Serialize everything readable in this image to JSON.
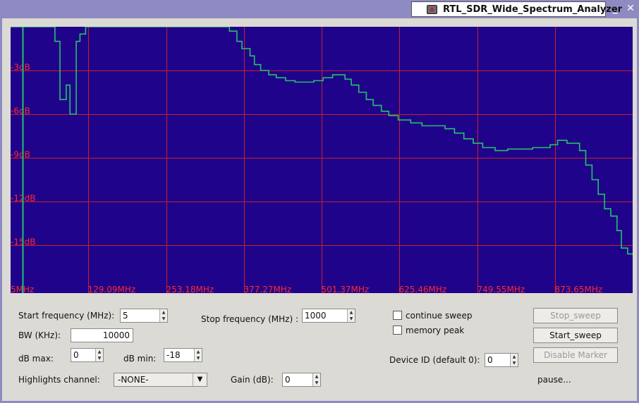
{
  "window": {
    "title": "RTL_SDR_Wide_Spectrum_Analyzer",
    "minimize_glyph": "_",
    "close_glyph": "✕"
  },
  "plot": {
    "colors": {
      "background": "#20038b",
      "grid": "#cc1e28",
      "trace": "#22c26a",
      "labels": "#ff2a2a"
    },
    "y_labels": [
      "-3dB",
      "-6dB",
      "-9dB",
      "-12dB",
      "-15dB"
    ],
    "x_labels": [
      "5MHz",
      "129.09MHz",
      "253.18MHz",
      "377.27MHz",
      "501.37MHz",
      "625.46MHz",
      "749.55MHz",
      "873.65MHz"
    ]
  },
  "chart_data": {
    "type": "line",
    "x_unit": "MHz",
    "y_unit": "dB",
    "ylim": [
      -18,
      0
    ],
    "xlim": [
      5,
      1000
    ],
    "series": [
      {
        "values": [
          [
            5,
            0
          ],
          [
            76,
            0
          ],
          [
            76,
            -1
          ],
          [
            84,
            -1
          ],
          [
            84,
            -5
          ],
          [
            94,
            -5
          ],
          [
            94,
            -4
          ],
          [
            100,
            -4
          ],
          [
            100,
            -6
          ],
          [
            110,
            -6
          ],
          [
            110,
            -1
          ],
          [
            116,
            -1
          ],
          [
            116,
            -0.5
          ],
          [
            125,
            -0.5
          ],
          [
            125,
            0
          ],
          [
            355,
            0
          ],
          [
            355,
            -0.3
          ],
          [
            367,
            -0.3
          ],
          [
            367,
            -1
          ],
          [
            375,
            -1
          ],
          [
            375,
            -1.5
          ],
          [
            388,
            -1.5
          ],
          [
            388,
            -2
          ],
          [
            395,
            -2
          ],
          [
            395,
            -2.6
          ],
          [
            405,
            -2.6
          ],
          [
            405,
            -3
          ],
          [
            418,
            -3
          ],
          [
            418,
            -3.3
          ],
          [
            430,
            -3.3
          ],
          [
            430,
            -3.5
          ],
          [
            445,
            -3.5
          ],
          [
            445,
            -3.7
          ],
          [
            460,
            -3.7
          ],
          [
            460,
            -3.8
          ],
          [
            490,
            -3.8
          ],
          [
            490,
            -3.7
          ],
          [
            505,
            -3.7
          ],
          [
            505,
            -3.5
          ],
          [
            520,
            -3.5
          ],
          [
            520,
            -3.3
          ],
          [
            540,
            -3.3
          ],
          [
            540,
            -3.6
          ],
          [
            550,
            -3.6
          ],
          [
            550,
            -4
          ],
          [
            562,
            -4
          ],
          [
            562,
            -4.5
          ],
          [
            574,
            -4.5
          ],
          [
            574,
            -5
          ],
          [
            585,
            -5
          ],
          [
            585,
            -5.4
          ],
          [
            598,
            -5.4
          ],
          [
            598,
            -5.8
          ],
          [
            610,
            -5.8
          ],
          [
            610,
            -6.1
          ],
          [
            625,
            -6.1
          ],
          [
            625,
            -6.4
          ],
          [
            645,
            -6.4
          ],
          [
            645,
            -6.6
          ],
          [
            663,
            -6.6
          ],
          [
            663,
            -6.8
          ],
          [
            700,
            -6.8
          ],
          [
            700,
            -7
          ],
          [
            715,
            -7
          ],
          [
            715,
            -7.3
          ],
          [
            730,
            -7.3
          ],
          [
            730,
            -7.7
          ],
          [
            745,
            -7.7
          ],
          [
            745,
            -8
          ],
          [
            760,
            -8
          ],
          [
            760,
            -8.3
          ],
          [
            780,
            -8.3
          ],
          [
            780,
            -8.5
          ],
          [
            800,
            -8.5
          ],
          [
            800,
            -8.4
          ],
          [
            840,
            -8.4
          ],
          [
            840,
            -8.3
          ],
          [
            868,
            -8.3
          ],
          [
            868,
            -8.1
          ],
          [
            880,
            -8.1
          ],
          [
            880,
            -7.8
          ],
          [
            895,
            -7.8
          ],
          [
            895,
            -8
          ],
          [
            915,
            -8
          ],
          [
            915,
            -8.5
          ],
          [
            925,
            -8.5
          ],
          [
            925,
            -9.5
          ],
          [
            935,
            -9.5
          ],
          [
            935,
            -10.5
          ],
          [
            945,
            -10.5
          ],
          [
            945,
            -11.5
          ],
          [
            955,
            -11.5
          ],
          [
            955,
            -12.5
          ],
          [
            965,
            -12.5
          ],
          [
            965,
            -13
          ],
          [
            975,
            -13
          ],
          [
            975,
            -14
          ],
          [
            982,
            -14
          ],
          [
            982,
            -15.2
          ],
          [
            992,
            -15.2
          ],
          [
            992,
            -15.6
          ],
          [
            1000,
            -15.6
          ]
        ]
      }
    ],
    "grid": true
  },
  "controls": {
    "start_freq_label": "Start frequency (MHz):",
    "start_freq_value": "5",
    "stop_freq_label": "Stop frequency (MHz) :",
    "stop_freq_value": "1000",
    "bw_label": "BW (KHz):",
    "bw_value": "10000",
    "db_max_label": "dB max:",
    "db_max_value": "0",
    "db_min_label": "dB min:",
    "db_min_value": "-18",
    "highlights_label": "Highlights channel:",
    "highlights_value": "-NONE-",
    "gain_label": "Gain (dB):",
    "gain_value": "0",
    "continue_sweep_label": "continue sweep",
    "memory_peak_label": "memory peak",
    "device_id_label": "Device ID (default 0):",
    "device_id_value": "0",
    "stop_sweep_label": "Stop_sweep",
    "start_sweep_label": "Start_sweep",
    "disable_marker_label": "Disable Marker",
    "status_text": "pause..."
  }
}
